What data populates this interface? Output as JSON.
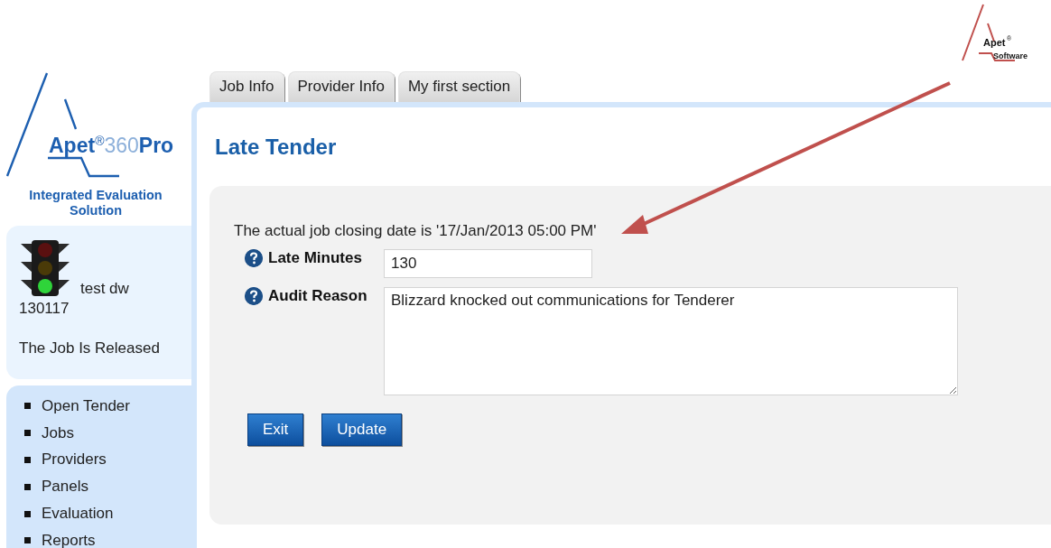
{
  "corner_logo": {
    "name": "Apet",
    "mark": "®",
    "sub": "Software"
  },
  "logo": {
    "name": "Apet",
    "mark": "®",
    "number": "360",
    "suffix": "Pro",
    "tagline": "Integrated Evaluation Solution"
  },
  "job_card": {
    "lights": [
      {
        "on": false
      },
      {
        "on": false
      },
      {
        "on": true
      }
    ],
    "job_name": "test dw",
    "job_number": "130117",
    "status": "The Job Is Released"
  },
  "nav": {
    "items": [
      "Open Tender",
      "Jobs",
      "Providers",
      "Panels",
      "Evaluation",
      "Reports"
    ]
  },
  "tabs": [
    {
      "label": "Job Info"
    },
    {
      "label": "Provider Info"
    },
    {
      "label": "My first section"
    }
  ],
  "page": {
    "title": "Late Tender",
    "notice": "The actual job closing date is '17/Jan/2013 05:00 PM'",
    "fields": [
      {
        "kind": "input",
        "label": "Late Minutes",
        "value": "130"
      },
      {
        "kind": "textarea",
        "label": "Audit Reason",
        "value": "Blizzard knocked out communications for Tenderer"
      }
    ],
    "buttons": [
      "Exit",
      "Update"
    ]
  }
}
